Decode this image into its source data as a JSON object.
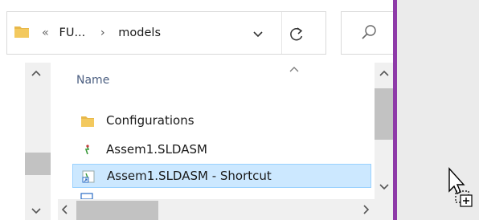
{
  "address_bar": {
    "crumbs": [
      "«",
      "FU...",
      "›",
      "models"
    ]
  },
  "file_list": {
    "column_header": "Name",
    "items": [
      {
        "name": "Configurations",
        "icon": "folder-icon"
      },
      {
        "name": "Assem1.SLDASM",
        "icon": "solidworks-assembly-icon"
      },
      {
        "name": "Assem1.SLDASM - Shortcut",
        "icon": "shortcut-icon",
        "selected": true
      }
    ]
  },
  "colors": {
    "selection": "#cce8ff",
    "selection_border": "#99d1ff",
    "header_text": "#4d6082",
    "folder": "#e8b84a",
    "window_edge": "#8e3aa8"
  }
}
